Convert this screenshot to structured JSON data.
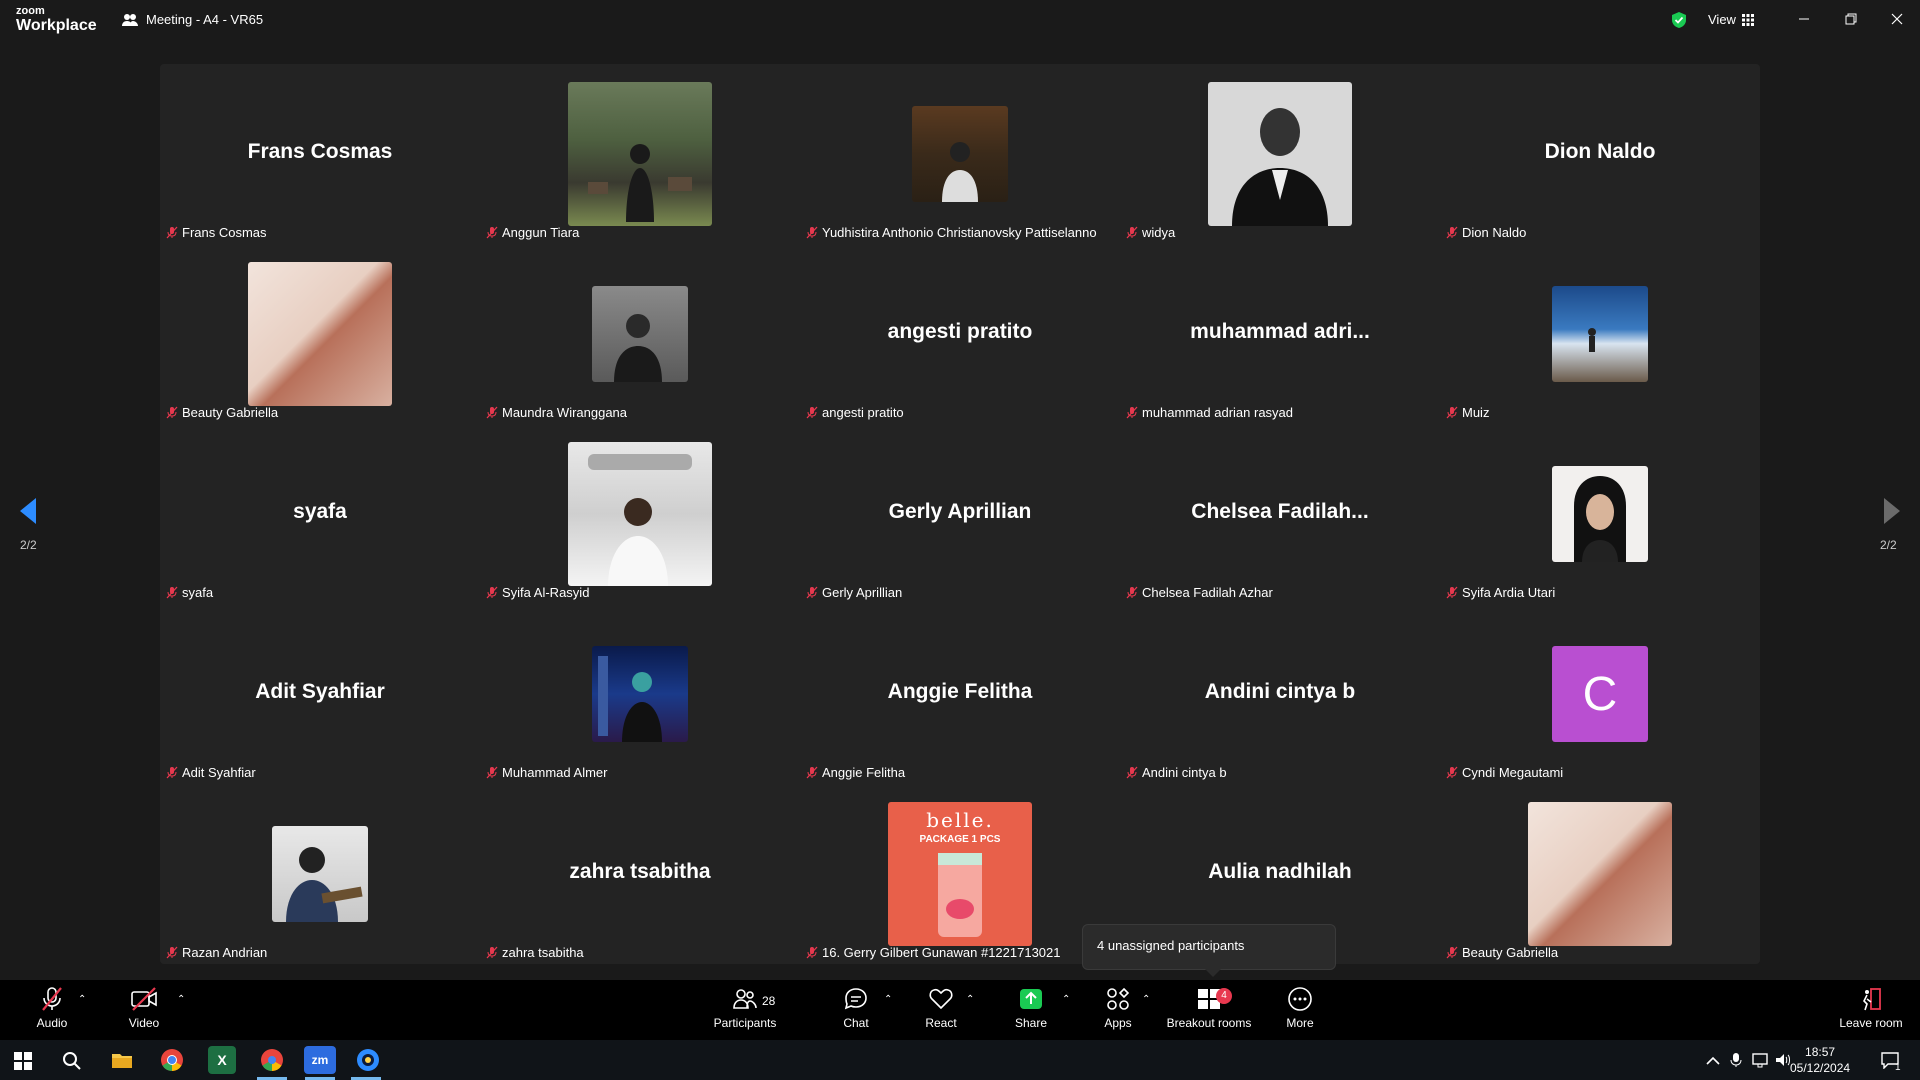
{
  "window": {
    "logo_top": "zoom",
    "logo_bottom": "Workplace",
    "title": "Meeting - A4 - VR65",
    "view_label": "View"
  },
  "gallery": {
    "page_indicator": "2/2",
    "tiles": [
      {
        "big": "Frans Cosmas",
        "label": "Frans Cosmas"
      },
      {
        "big": "",
        "label": "Anggun Tiara"
      },
      {
        "big": "",
        "label": "Yudhistira Anthonio Christianovsky Pattiselanno"
      },
      {
        "big": "",
        "label": "widya"
      },
      {
        "big": "Dion Naldo",
        "label": "Dion Naldo"
      },
      {
        "big": "",
        "label": "Beauty Gabriella"
      },
      {
        "big": "",
        "label": "Maundra Wiranggana"
      },
      {
        "big": "angesti pratito",
        "label": "angesti pratito"
      },
      {
        "big": "muhammad  adri...",
        "label": "muhammad adrian rasyad"
      },
      {
        "big": "",
        "label": "Muiz"
      },
      {
        "big": "syafa",
        "label": "syafa"
      },
      {
        "big": "",
        "label": "Syifa Al-Rasyid"
      },
      {
        "big": "Gerly Aprillian",
        "label": "Gerly Aprillian"
      },
      {
        "big": "Chelsea  Fadilah...",
        "label": "Chelsea Fadilah Azhar"
      },
      {
        "big": "",
        "label": "Syifa Ardia Utari"
      },
      {
        "big": "Adit Syahfiar",
        "label": "Adit Syahfiar"
      },
      {
        "big": "",
        "label": "Muhammad Almer"
      },
      {
        "big": "Anggie Felitha",
        "label": "Anggie Felitha"
      },
      {
        "big": "Andini cintya b",
        "label": "Andini cintya b"
      },
      {
        "big": "",
        "label": "Cyndi Megautami"
      },
      {
        "big": "",
        "label": "Razan Andrian"
      },
      {
        "big": "zahra tsabitha",
        "label": "zahra tsabitha"
      },
      {
        "big": "",
        "label": "16. Gerry Gilbert Gunawan #1221713021"
      },
      {
        "big": "Aulia nadhilah",
        "label": ""
      },
      {
        "big": "",
        "label": "Beauty Gabriella"
      }
    ],
    "avatar_letter": "C",
    "product_brand": "belle.",
    "product_text": "PACKAGE 1 PCS"
  },
  "tooltip": "4 unassigned participants",
  "toolbar": {
    "audio": "Audio",
    "video": "Video",
    "participants": "Participants",
    "participants_count": "28",
    "chat": "Chat",
    "react": "React",
    "share": "Share",
    "apps": "Apps",
    "breakout": "Breakout rooms",
    "breakout_badge": "4",
    "more": "More",
    "leave": "Leave room"
  },
  "taskbar": {
    "time": "18:57",
    "date": "05/12/2024",
    "notif_count": "1",
    "zoom_label": "zm"
  },
  "colors": {
    "accent_green": "#1aca53",
    "avatar_purple": "#b94fd1",
    "nav_blue": "#2d8cff",
    "badge_red": "#e8384f"
  }
}
